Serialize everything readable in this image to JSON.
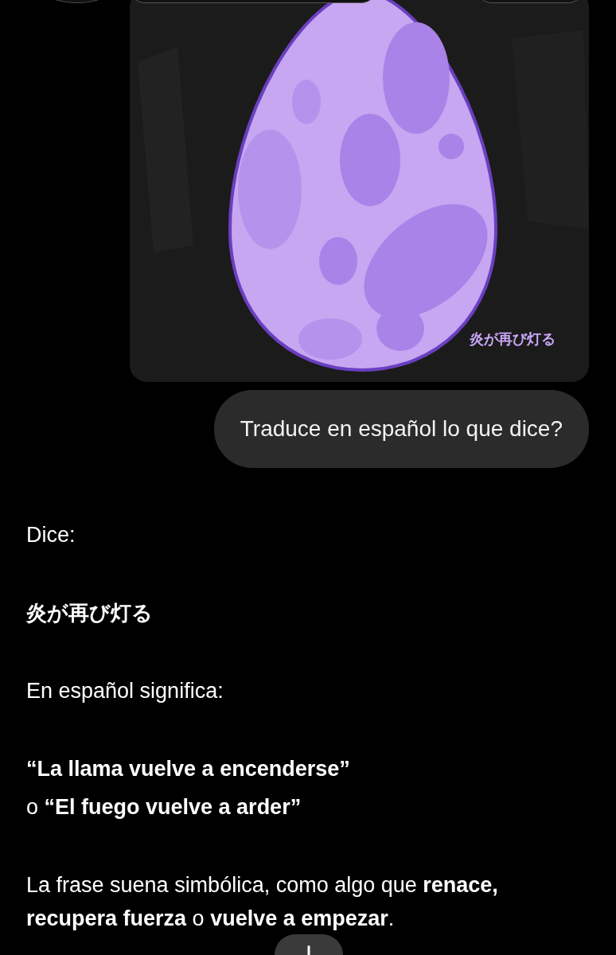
{
  "image_card": {
    "kind": "picture",
    "caption": "炎が再び灯る"
  },
  "user_message": {
    "text": "Traduce en español lo que dice?"
  },
  "response": [
    {
      "kind": "plain",
      "text": "Dice:"
    },
    {
      "kind": "strong",
      "text": "炎が再び灯る"
    },
    {
      "kind": "plain",
      "text": "En español significa:"
    },
    {
      "kind": "lines",
      "lines": [
        "**“La llama vuelve a encenderse”**",
        "o **“El fuego vuelve a arder”**"
      ]
    },
    {
      "kind": "plain",
      "text": "La frase suena simbólica, como algo que **renace, recupera fuerza** o **vuelve a empezar**."
    }
  ]
}
